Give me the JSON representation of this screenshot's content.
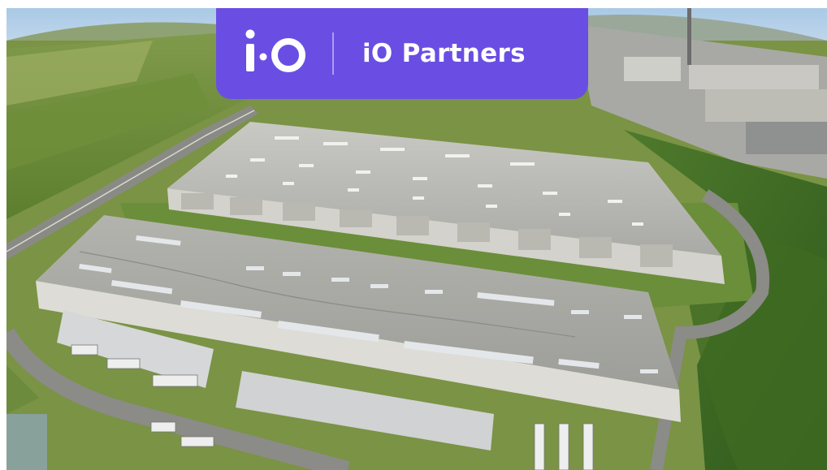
{
  "scene": {
    "subject": "aerial-view-warehouse-logistics-park"
  },
  "banner": {
    "logo_text": "i·O",
    "brand_name": "iO Partners",
    "color": "#6a4ee3",
    "text_color": "#ffffff"
  }
}
